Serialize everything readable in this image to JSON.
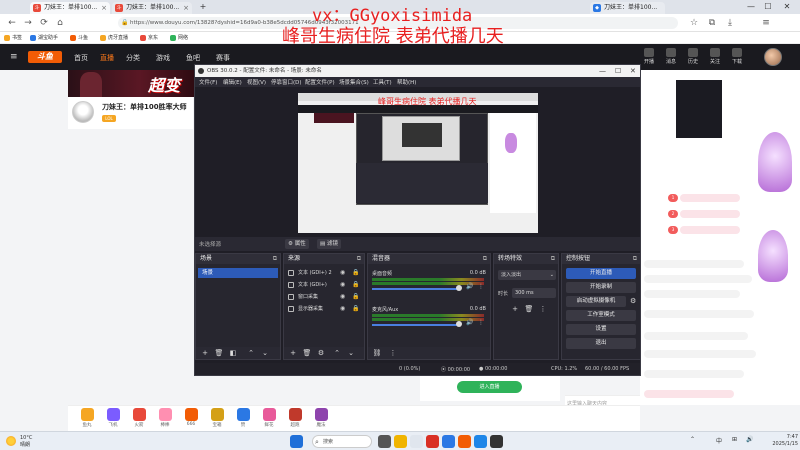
{
  "browser": {
    "tabs": [
      {
        "label": "刀妹王：单排100...",
        "active": true
      },
      {
        "label": "刀妹王：单排100...",
        "active": false
      }
    ],
    "url": "https://www.douyu.com/13828?dyshid=16d9a0-b38e5dcdd05746d0943f32003171",
    "bookmarks": [
      "书签",
      "湖宝助手",
      "斗鱼",
      "虎牙直播",
      "京东",
      "网络"
    ],
    "window_controls": [
      "—",
      "☐",
      "✕"
    ]
  },
  "overlay": {
    "line1": "vx：GGyoxisimida",
    "line2": "峰哥生病住院 表弟代播几天"
  },
  "site": {
    "logo": "斗鱼",
    "nav": [
      "首页",
      "直播",
      "分类",
      "游戏",
      "鱼吧",
      "赛事"
    ],
    "active_nav": "直播",
    "right_icons": [
      "开播",
      "消息",
      "历史",
      "关注",
      "下载"
    ],
    "banner_text": "超变",
    "streamer_name": "刀妹王：单排100胜率大师",
    "tag": "LOL",
    "chat_placeholder": "这里输入聊天内容",
    "watch_button": "进入直播",
    "gifts": [
      "鱼丸",
      "飞机",
      "火箭",
      "棒棒",
      "666",
      "宝箱",
      "赞",
      "鲜花",
      "超跑",
      "魔法"
    ]
  },
  "obs": {
    "title": "OBS 30.0.2 - 配置文件: 未命名 - 场景: 未命名",
    "menu": [
      "文件(F)",
      "编辑(E)",
      "视图(V)",
      "停靠窗口(D)",
      "配置文件(P)",
      "场景集合(S)",
      "工具(T)",
      "帮助(H)"
    ],
    "toolbar": {
      "label": "未选择源",
      "properties": "属性",
      "filters": "滤镜"
    },
    "docks": {
      "scenes": "场景",
      "sources": "来源",
      "mixer": "混音器",
      "transitions": "转场特效",
      "controls": "控制按钮"
    },
    "scenes": [
      "场景"
    ],
    "sources": [
      "文本 (GDI+) 2",
      "文本 (GDI+)",
      "窗口采集",
      "显示器采集"
    ],
    "mixer": [
      {
        "name": "桌面音频",
        "db": "0.0 dB"
      },
      {
        "name": "麦克风/Aux",
        "db": "0.0 dB"
      }
    ],
    "transitions": {
      "type": "淡入淡出",
      "duration_label": "时长",
      "duration": "300 ms"
    },
    "controls": [
      "开始直播",
      "开始录制",
      "启动虚拟摄像机",
      "工作室模式",
      "设置",
      "退出"
    ],
    "status": {
      "drop": "0 (0.0%)",
      "live": "00:00:00",
      "rec": "00:00:00",
      "cpu": "CPU: 1.2%",
      "fps": "60.00 / 60.00 FPS"
    }
  },
  "taskbar": {
    "weather_temp": "10°C",
    "weather_desc": "晴朗",
    "search": "搜索",
    "lang": "中",
    "time": "7:47",
    "date": "2025/1/15"
  },
  "colors": {
    "obs_bg": "#1f1e26",
    "obs_accent": "#2d5bb8",
    "douyu_orange": "#f25c05",
    "overlay_red": "#e82020"
  }
}
